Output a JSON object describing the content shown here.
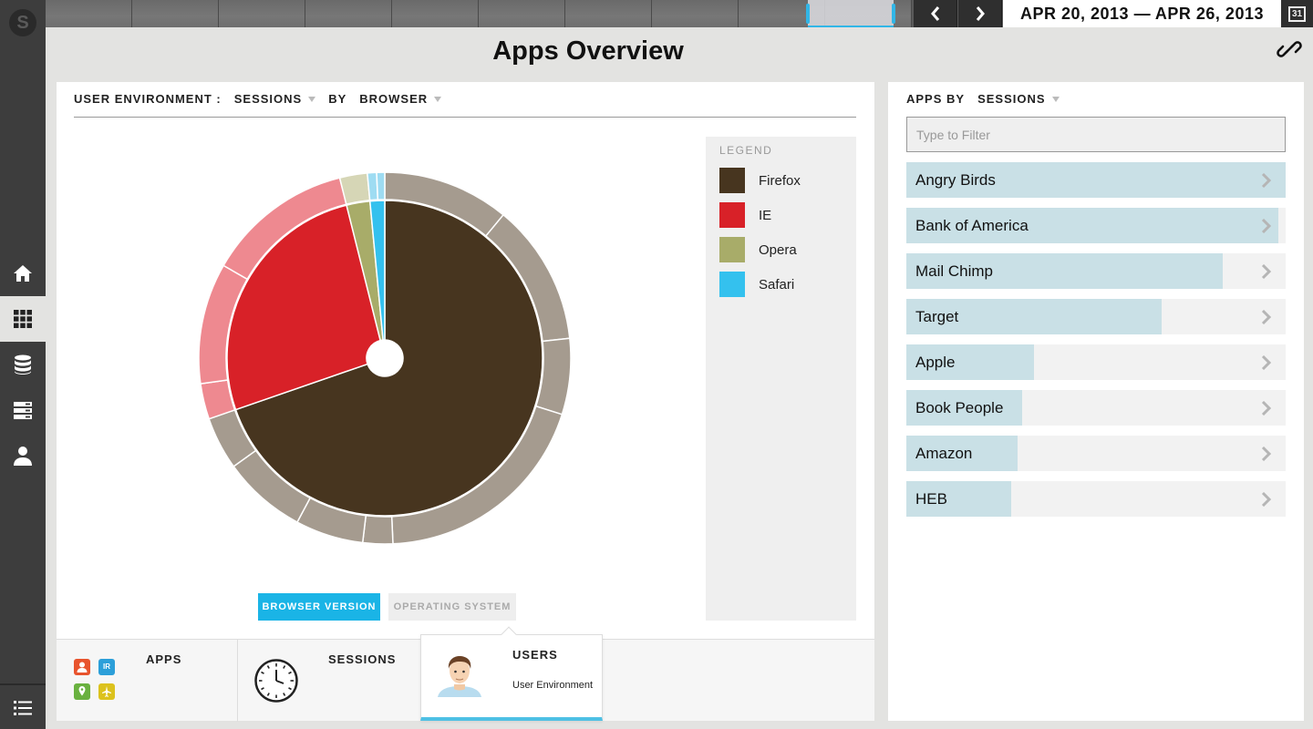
{
  "date_range": "APR 20, 2013 — APR 26, 2013",
  "calendar_day": "31",
  "page_title": "Apps Overview",
  "main_card": {
    "header": {
      "label": "USER ENVIRONMENT :",
      "metric": "SESSIONS",
      "by": "BY",
      "dimension": "BROWSER"
    },
    "legend_title": "LEGEND",
    "legend": [
      {
        "label": "Firefox",
        "color": "#47351f"
      },
      {
        "label": "IE",
        "color": "#d82128"
      },
      {
        "label": "Opera",
        "color": "#a8ac69"
      },
      {
        "label": "Safari",
        "color": "#34c1ee"
      }
    ],
    "toggle": {
      "active": "BROWSER VERSION",
      "inactive": "OPERATING SYSTEM"
    }
  },
  "chart_data": {
    "type": "pie",
    "subtype": "sunburst",
    "categories": [
      "Firefox",
      "IE",
      "Opera",
      "Safari"
    ],
    "values": [
      69.7,
      26.4,
      2.4,
      1.5
    ],
    "colors": [
      "#47351f",
      "#d82128",
      "#a8ac69",
      "#34c1ee"
    ],
    "outer_ring_colors": [
      "#a59b8f",
      "#ee8990",
      "#d6d6b6",
      "#9edcf2"
    ],
    "outer_ring": [
      {
        "parent": "Firefox",
        "values": [
          11.0,
          12.3,
          6.6,
          19.4,
          2.6,
          5.9,
          7.3,
          4.6
        ]
      },
      {
        "parent": "IE",
        "values": [
          3.1,
          10.5,
          12.8
        ]
      },
      {
        "parent": "Opera",
        "values": [
          2.4
        ]
      },
      {
        "parent": "Safari",
        "values": [
          0.8,
          0.7
        ]
      }
    ]
  },
  "bottom_tabs": {
    "apps_label": "APPS",
    "apps_mini": [
      "",
      "IR",
      "",
      ""
    ],
    "sessions_label": "SESSIONS",
    "users_label": "USERS",
    "users_sub": "User Environment"
  },
  "right_card": {
    "header": {
      "label": "APPS BY",
      "metric": "SESSIONS"
    },
    "filter_placeholder": "Type to Filter",
    "apps": [
      {
        "name": "Angry Birds",
        "value": 1.0
      },
      {
        "name": "Bank of America",
        "value": 0.98
      },
      {
        "name": "Mail Chimp",
        "value": 0.835
      },
      {
        "name": "Target",
        "value": 0.672
      },
      {
        "name": "Apple",
        "value": 0.337
      },
      {
        "name": "Book People",
        "value": 0.306
      },
      {
        "name": "Amazon",
        "value": 0.294
      },
      {
        "name": "HEB",
        "value": 0.276
      }
    ]
  }
}
